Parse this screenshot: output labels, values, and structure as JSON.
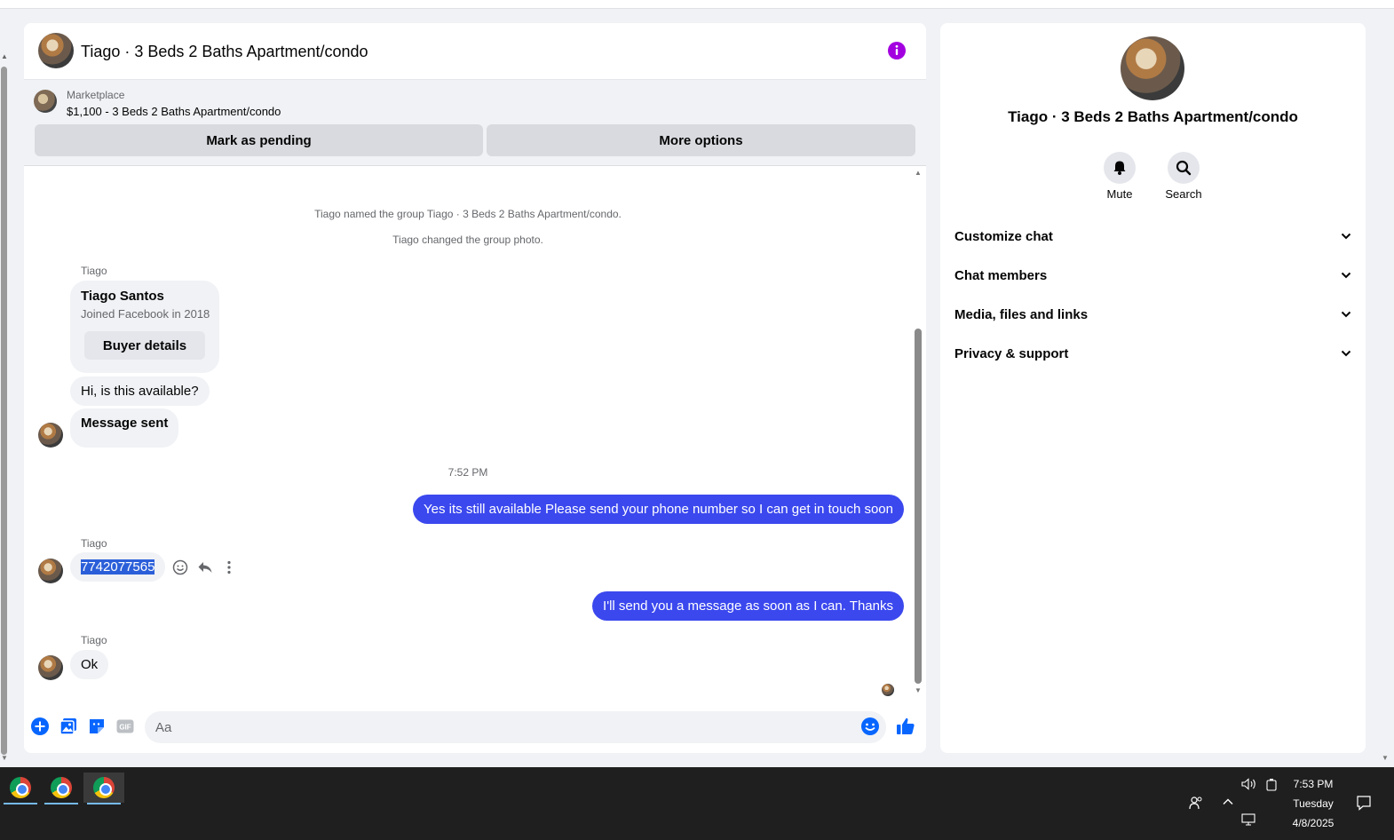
{
  "chat": {
    "title": "Tiago · 3 Beds 2 Baths Apartment/condo",
    "marketplace_label": "Marketplace",
    "listing": "$1,100 - 3 Beds 2 Baths Apartment/condo",
    "mark_pending_label": "Mark as pending",
    "more_options_label": "More options",
    "messages": {
      "system1": "Tiago named the group Tiago · 3 Beds 2 Baths Apartment/condo.",
      "system2": "Tiago changed the group photo.",
      "sender1": "Tiago",
      "card_name": "Tiago Santos",
      "card_joined": "Joined Facebook in 2018",
      "card_button": "Buyer details",
      "msg_available": "Hi, is this available?",
      "msg_sent": "Message sent",
      "timestamp": "7:52 PM",
      "out1": "Yes its still available Please send your phone number so I can get in touch soon",
      "sender2": "Tiago",
      "phone": "7742077565",
      "out2": "I'll send you a message as soon as I can. Thanks",
      "sender3": "Tiago",
      "ok": "Ok"
    },
    "composer_placeholder": "Aa"
  },
  "info": {
    "title": "Tiago · 3 Beds 2 Baths Apartment/condo",
    "mute_label": "Mute",
    "search_label": "Search",
    "sections": [
      "Customize chat",
      "Chat members",
      "Media, files and links",
      "Privacy & support"
    ]
  },
  "taskbar": {
    "time": "7:53 PM",
    "day": "Tuesday",
    "date": "4/8/2025"
  },
  "colors": {
    "outgoing_bubble": "#3b48ee",
    "accent_blue": "#0866ff",
    "info_icon": "#a300e0"
  }
}
